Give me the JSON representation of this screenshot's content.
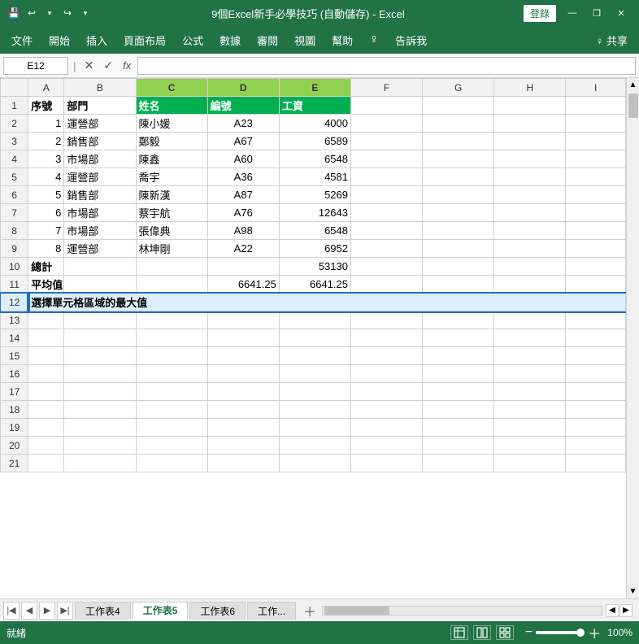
{
  "titleBar": {
    "title": "9個Excel新手必學技巧 (自動儲存) - Excel",
    "loginLabel": "登錄",
    "minimizeIcon": "—",
    "restoreIcon": "❐",
    "closeIcon": "✕"
  },
  "quickAccess": {
    "saveIcon": "💾",
    "undoIcon": "↩",
    "redoIcon": "↪",
    "moreIcon": "▾"
  },
  "menuBar": {
    "items": [
      "文件",
      "開始",
      "插入",
      "頁面布局",
      "公式",
      "數據",
      "審閱",
      "視圖",
      "幫助",
      "♀",
      "告訴我",
      "♀ 共享"
    ]
  },
  "formulaBar": {
    "cellRef": "E12",
    "cancelIcon": "✕",
    "confirmIcon": "✓",
    "fxLabel": "fx"
  },
  "columns": {
    "headers": [
      "",
      "A",
      "B",
      "C",
      "D",
      "E",
      "F",
      "G",
      "H",
      "I"
    ]
  },
  "rows": [
    {
      "num": "1",
      "a": "序號",
      "b": "部門",
      "c": "姓名",
      "d": "編號",
      "e": "工資",
      "f": "",
      "g": "",
      "h": "",
      "i": ""
    },
    {
      "num": "2",
      "a": "1",
      "b": "運營部",
      "c": "陳小媛",
      "d": "A23",
      "e": "4000",
      "f": "",
      "g": "",
      "h": "",
      "i": ""
    },
    {
      "num": "3",
      "a": "2",
      "b": "銷售部",
      "c": "鄭毅",
      "d": "A67",
      "e": "6589",
      "f": "",
      "g": "",
      "h": "",
      "i": ""
    },
    {
      "num": "4",
      "a": "3",
      "b": "市場部",
      "c": "陳鑫",
      "d": "A60",
      "e": "6548",
      "f": "",
      "g": "",
      "h": "",
      "i": ""
    },
    {
      "num": "5",
      "a": "4",
      "b": "運營部",
      "c": "喬宇",
      "d": "A36",
      "e": "4581",
      "f": "",
      "g": "",
      "h": "",
      "i": ""
    },
    {
      "num": "6",
      "a": "5",
      "b": "銷售部",
      "c": "陳新漢",
      "d": "A87",
      "e": "5269",
      "f": "",
      "g": "",
      "h": "",
      "i": ""
    },
    {
      "num": "7",
      "a": "6",
      "b": "市場部",
      "c": "蔡宇航",
      "d": "A76",
      "e": "12643",
      "f": "",
      "g": "",
      "h": "",
      "i": ""
    },
    {
      "num": "8",
      "a": "7",
      "b": "市場部",
      "c": "張偉典",
      "d": "A98",
      "e": "6548",
      "f": "",
      "g": "",
      "h": "",
      "i": ""
    },
    {
      "num": "9",
      "a": "8",
      "b": "運營部",
      "c": "林坤剛",
      "d": "A22",
      "e": "6952",
      "f": "",
      "g": "",
      "h": "",
      "i": ""
    },
    {
      "num": "10",
      "a": "總計",
      "b": "",
      "c": "",
      "d": "",
      "e": "53130",
      "f": "",
      "g": "",
      "h": "",
      "i": ""
    },
    {
      "num": "11",
      "a": "平均值",
      "b": "",
      "c": "",
      "d": "6641.25",
      "e": "6641.25",
      "f": "",
      "g": "",
      "h": "",
      "i": ""
    },
    {
      "num": "12",
      "a": "選擇單元格區域的最大值",
      "b": "",
      "c": "",
      "d": "",
      "e": "",
      "f": "",
      "g": "",
      "h": "",
      "i": ""
    },
    {
      "num": "13",
      "a": "",
      "b": "",
      "c": "",
      "d": "",
      "e": "",
      "f": "",
      "g": "",
      "h": "",
      "i": ""
    },
    {
      "num": "14",
      "a": "",
      "b": "",
      "c": "",
      "d": "",
      "e": "",
      "f": "",
      "g": "",
      "h": "",
      "i": ""
    },
    {
      "num": "15",
      "a": "",
      "b": "",
      "c": "",
      "d": "",
      "e": "",
      "f": "",
      "g": "",
      "h": "",
      "i": ""
    },
    {
      "num": "16",
      "a": "",
      "b": "",
      "c": "",
      "d": "",
      "e": "",
      "f": "",
      "g": "",
      "h": "",
      "i": ""
    },
    {
      "num": "17",
      "a": "",
      "b": "",
      "c": "",
      "d": "",
      "e": "",
      "f": "",
      "g": "",
      "h": "",
      "i": ""
    },
    {
      "num": "18",
      "a": "",
      "b": "",
      "c": "",
      "d": "",
      "e": "",
      "f": "",
      "g": "",
      "h": "",
      "i": ""
    },
    {
      "num": "19",
      "a": "",
      "b": "",
      "c": "",
      "d": "",
      "e": "",
      "f": "",
      "g": "",
      "h": "",
      "i": ""
    },
    {
      "num": "20",
      "a": "",
      "b": "",
      "c": "",
      "d": "",
      "e": "",
      "f": "",
      "g": "",
      "h": "",
      "i": ""
    },
    {
      "num": "21",
      "a": "",
      "b": "",
      "c": "",
      "d": "",
      "e": "",
      "f": "",
      "g": "",
      "h": "",
      "i": ""
    }
  ],
  "sheetTabs": {
    "tabs": [
      "工作表4",
      "工作表5",
      "工作表6",
      "工作..."
    ],
    "activeTab": "工作表5",
    "addLabel": "+"
  },
  "statusBar": {
    "statusText": "就緒",
    "zoomLevel": "100%",
    "viewIcons": [
      "grid",
      "page",
      "preview"
    ]
  }
}
